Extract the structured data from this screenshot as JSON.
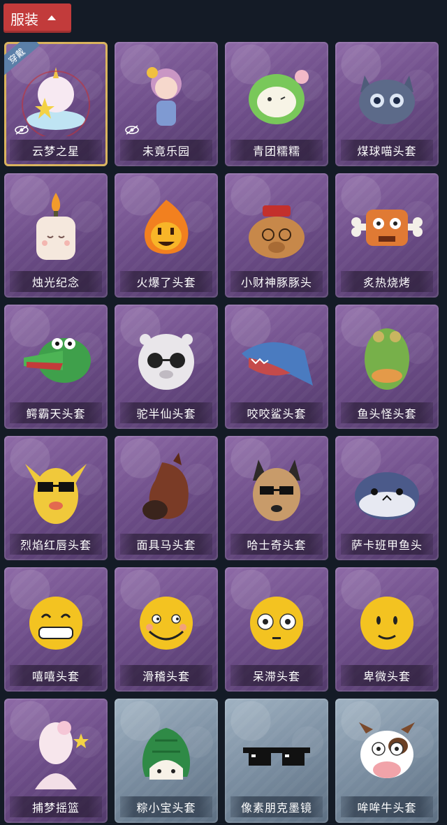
{
  "header": {
    "label": "服装",
    "icon": "chevron-up-icon"
  },
  "colors": {
    "tab_red": "#c23b3b",
    "card_purple": "#6d4d88",
    "card_blue": "#7b8ea1",
    "background": "#141b26"
  },
  "items": [
    {
      "name": "云梦之星",
      "icon": "unicorn-star-costume-icon",
      "badge": "穿戴",
      "hidden_icon": true,
      "variant": "purple"
    },
    {
      "name": "未竟乐园",
      "icon": "clown-girl-costume-icon",
      "hidden_icon": true,
      "variant": "purple"
    },
    {
      "name": "青团糯糯",
      "icon": "green-rice-ball-head-icon",
      "variant": "purple"
    },
    {
      "name": "煤球喵头套",
      "icon": "grey-cat-head-icon",
      "variant": "purple"
    },
    {
      "name": "烛光纪念",
      "icon": "candle-head-icon",
      "variant": "purple"
    },
    {
      "name": "火爆了头套",
      "icon": "fire-head-icon",
      "variant": "purple"
    },
    {
      "name": "小财神豚豚头",
      "icon": "capybara-god-head-icon",
      "variant": "purple"
    },
    {
      "name": "炙热烧烤",
      "icon": "bbq-meat-head-icon",
      "variant": "purple"
    },
    {
      "name": "鳄霸天头套",
      "icon": "crocodile-head-icon",
      "variant": "purple"
    },
    {
      "name": "驼半仙头套",
      "icon": "alpaca-sunglasses-head-icon",
      "variant": "purple"
    },
    {
      "name": "咬咬鲨头套",
      "icon": "shark-head-icon",
      "variant": "purple"
    },
    {
      "name": "鱼头怪头套",
      "icon": "fish-head-icon",
      "variant": "purple"
    },
    {
      "name": "烈焰红唇头套",
      "icon": "yellow-creature-sunglasses-head-icon",
      "variant": "purple"
    },
    {
      "name": "面具马头套",
      "icon": "horse-head-icon",
      "variant": "purple"
    },
    {
      "name": "哈士奇头套",
      "icon": "husky-sunglasses-head-icon",
      "variant": "purple"
    },
    {
      "name": "萨卡班甲鱼头",
      "icon": "sacabambaspis-head-icon",
      "variant": "purple"
    },
    {
      "name": "嘻嘻头套",
      "icon": "grinning-emoji-head-icon",
      "variant": "purple"
    },
    {
      "name": "滑稽头套",
      "icon": "smirk-emoji-head-icon",
      "variant": "purple"
    },
    {
      "name": "呆滞头套",
      "icon": "dazed-emoji-head-icon",
      "variant": "purple"
    },
    {
      "name": "卑微头套",
      "icon": "humble-emoji-head-icon",
      "variant": "purple"
    },
    {
      "name": "捕梦摇篮",
      "icon": "dreamcatcher-figure-icon",
      "variant": "purple"
    },
    {
      "name": "粽小宝头套",
      "icon": "zongzi-head-icon",
      "variant": "blue"
    },
    {
      "name": "像素朋克墨镜",
      "icon": "pixel-sunglasses-icon",
      "variant": "blue"
    },
    {
      "name": "哞哞牛头套",
      "icon": "cow-head-icon",
      "variant": "blue"
    }
  ]
}
